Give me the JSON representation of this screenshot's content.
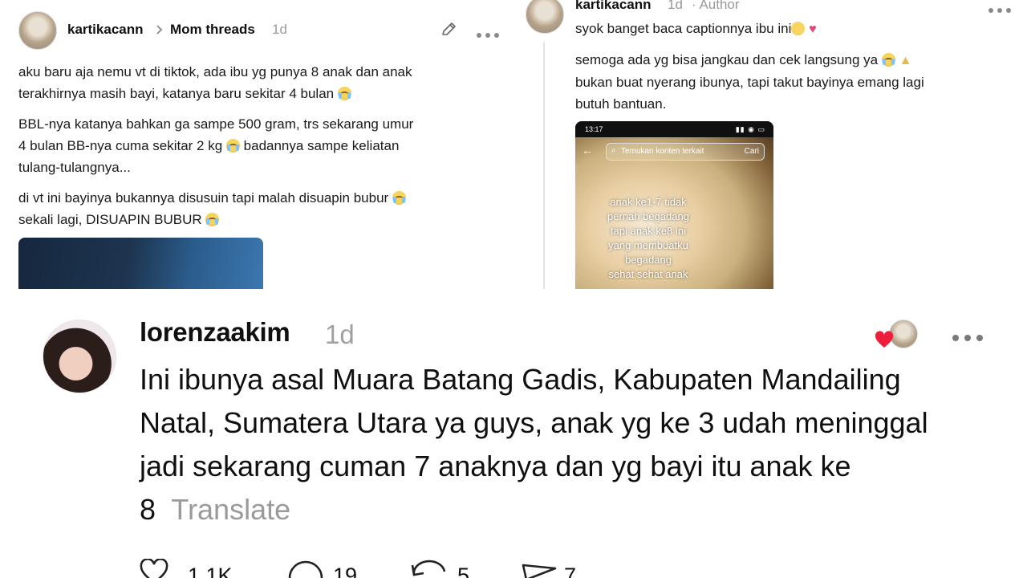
{
  "post_left": {
    "username": "kartikacann",
    "community": "Mom threads",
    "time": "1d",
    "paragraph1_a": "aku baru aja nemu vt di tiktok, ada ibu yg punya 8 anak dan anak",
    "paragraph1_b": "terakhirnya masih bayi, katanya baru sekitar 4 bulan",
    "paragraph2_a": "BBL-nya katanya bahkan ga sampe 500 gram, trs sekarang umur",
    "paragraph2_b": "4 bulan BB-nya cuma sekitar 2 kg",
    "paragraph2_c": "badannya sampe keliatan",
    "paragraph2_d": "tulang-tulangnya...",
    "paragraph3_a": "di vt ini bayinya bukannya disusuin tapi malah disuapin bubur",
    "paragraph3_b": "sekali lagi, DISUAPIN BUBUR"
  },
  "post_right": {
    "username": "kartikacann",
    "time": "1d",
    "role": "· Author",
    "line1": "syok banget baca captionnya ibu ini",
    "line2": "semoga ada yg bisa jangkau dan cek langsung ya",
    "line3": "bukan buat nyerang ibunya, tapi takut bayinya emang lagi",
    "line4": "butuh bantuan.",
    "phone_time": "13:17",
    "phone_search": "Temukan konten terkait",
    "phone_search_button": "Cari",
    "overlay_lines": [
      "anak ke1-7 tidak",
      "pernah begadang",
      "tapi anak ke8 ini",
      "yang membuatku",
      "begadang",
      "sehat sehat anak"
    ]
  },
  "comment": {
    "username": "lorenzaakim",
    "time": "1d",
    "line1": "Ini ibunya asal Muara Batang Gadis, Kabupaten Mandailing",
    "line2": "Natal, Sumatera Utara ya guys, anak yg ke 3 udah meninggal",
    "line3": "jadi sekarang cuman 7 anaknya dan yg bayi itu anak ke",
    "line4": "8",
    "translate": "Translate",
    "likes": "1,1K",
    "replies": "19",
    "reposts": "5",
    "shares": "7"
  }
}
